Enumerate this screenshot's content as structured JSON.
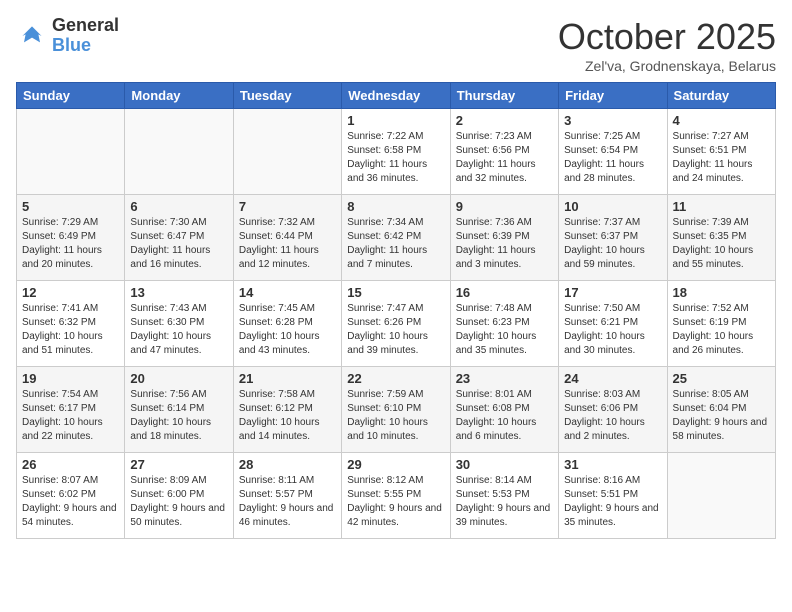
{
  "header": {
    "logo_line1": "General",
    "logo_line2": "Blue",
    "title": "October 2025",
    "subtitle": "Zel'va, Grodnenskaya, Belarus"
  },
  "weekdays": [
    "Sunday",
    "Monday",
    "Tuesday",
    "Wednesday",
    "Thursday",
    "Friday",
    "Saturday"
  ],
  "weeks": [
    [
      {
        "day": "",
        "text": ""
      },
      {
        "day": "",
        "text": ""
      },
      {
        "day": "",
        "text": ""
      },
      {
        "day": "1",
        "text": "Sunrise: 7:22 AM\nSunset: 6:58 PM\nDaylight: 11 hours and 36 minutes."
      },
      {
        "day": "2",
        "text": "Sunrise: 7:23 AM\nSunset: 6:56 PM\nDaylight: 11 hours and 32 minutes."
      },
      {
        "day": "3",
        "text": "Sunrise: 7:25 AM\nSunset: 6:54 PM\nDaylight: 11 hours and 28 minutes."
      },
      {
        "day": "4",
        "text": "Sunrise: 7:27 AM\nSunset: 6:51 PM\nDaylight: 11 hours and 24 minutes."
      }
    ],
    [
      {
        "day": "5",
        "text": "Sunrise: 7:29 AM\nSunset: 6:49 PM\nDaylight: 11 hours and 20 minutes."
      },
      {
        "day": "6",
        "text": "Sunrise: 7:30 AM\nSunset: 6:47 PM\nDaylight: 11 hours and 16 minutes."
      },
      {
        "day": "7",
        "text": "Sunrise: 7:32 AM\nSunset: 6:44 PM\nDaylight: 11 hours and 12 minutes."
      },
      {
        "day": "8",
        "text": "Sunrise: 7:34 AM\nSunset: 6:42 PM\nDaylight: 11 hours and 7 minutes."
      },
      {
        "day": "9",
        "text": "Sunrise: 7:36 AM\nSunset: 6:39 PM\nDaylight: 11 hours and 3 minutes."
      },
      {
        "day": "10",
        "text": "Sunrise: 7:37 AM\nSunset: 6:37 PM\nDaylight: 10 hours and 59 minutes."
      },
      {
        "day": "11",
        "text": "Sunrise: 7:39 AM\nSunset: 6:35 PM\nDaylight: 10 hours and 55 minutes."
      }
    ],
    [
      {
        "day": "12",
        "text": "Sunrise: 7:41 AM\nSunset: 6:32 PM\nDaylight: 10 hours and 51 minutes."
      },
      {
        "day": "13",
        "text": "Sunrise: 7:43 AM\nSunset: 6:30 PM\nDaylight: 10 hours and 47 minutes."
      },
      {
        "day": "14",
        "text": "Sunrise: 7:45 AM\nSunset: 6:28 PM\nDaylight: 10 hours and 43 minutes."
      },
      {
        "day": "15",
        "text": "Sunrise: 7:47 AM\nSunset: 6:26 PM\nDaylight: 10 hours and 39 minutes."
      },
      {
        "day": "16",
        "text": "Sunrise: 7:48 AM\nSunset: 6:23 PM\nDaylight: 10 hours and 35 minutes."
      },
      {
        "day": "17",
        "text": "Sunrise: 7:50 AM\nSunset: 6:21 PM\nDaylight: 10 hours and 30 minutes."
      },
      {
        "day": "18",
        "text": "Sunrise: 7:52 AM\nSunset: 6:19 PM\nDaylight: 10 hours and 26 minutes."
      }
    ],
    [
      {
        "day": "19",
        "text": "Sunrise: 7:54 AM\nSunset: 6:17 PM\nDaylight: 10 hours and 22 minutes."
      },
      {
        "day": "20",
        "text": "Sunrise: 7:56 AM\nSunset: 6:14 PM\nDaylight: 10 hours and 18 minutes."
      },
      {
        "day": "21",
        "text": "Sunrise: 7:58 AM\nSunset: 6:12 PM\nDaylight: 10 hours and 14 minutes."
      },
      {
        "day": "22",
        "text": "Sunrise: 7:59 AM\nSunset: 6:10 PM\nDaylight: 10 hours and 10 minutes."
      },
      {
        "day": "23",
        "text": "Sunrise: 8:01 AM\nSunset: 6:08 PM\nDaylight: 10 hours and 6 minutes."
      },
      {
        "day": "24",
        "text": "Sunrise: 8:03 AM\nSunset: 6:06 PM\nDaylight: 10 hours and 2 minutes."
      },
      {
        "day": "25",
        "text": "Sunrise: 8:05 AM\nSunset: 6:04 PM\nDaylight: 9 hours and 58 minutes."
      }
    ],
    [
      {
        "day": "26",
        "text": "Sunrise: 8:07 AM\nSunset: 6:02 PM\nDaylight: 9 hours and 54 minutes."
      },
      {
        "day": "27",
        "text": "Sunrise: 8:09 AM\nSunset: 6:00 PM\nDaylight: 9 hours and 50 minutes."
      },
      {
        "day": "28",
        "text": "Sunrise: 8:11 AM\nSunset: 5:57 PM\nDaylight: 9 hours and 46 minutes."
      },
      {
        "day": "29",
        "text": "Sunrise: 8:12 AM\nSunset: 5:55 PM\nDaylight: 9 hours and 42 minutes."
      },
      {
        "day": "30",
        "text": "Sunrise: 8:14 AM\nSunset: 5:53 PM\nDaylight: 9 hours and 39 minutes."
      },
      {
        "day": "31",
        "text": "Sunrise: 8:16 AM\nSunset: 5:51 PM\nDaylight: 9 hours and 35 minutes."
      },
      {
        "day": "",
        "text": ""
      }
    ]
  ]
}
